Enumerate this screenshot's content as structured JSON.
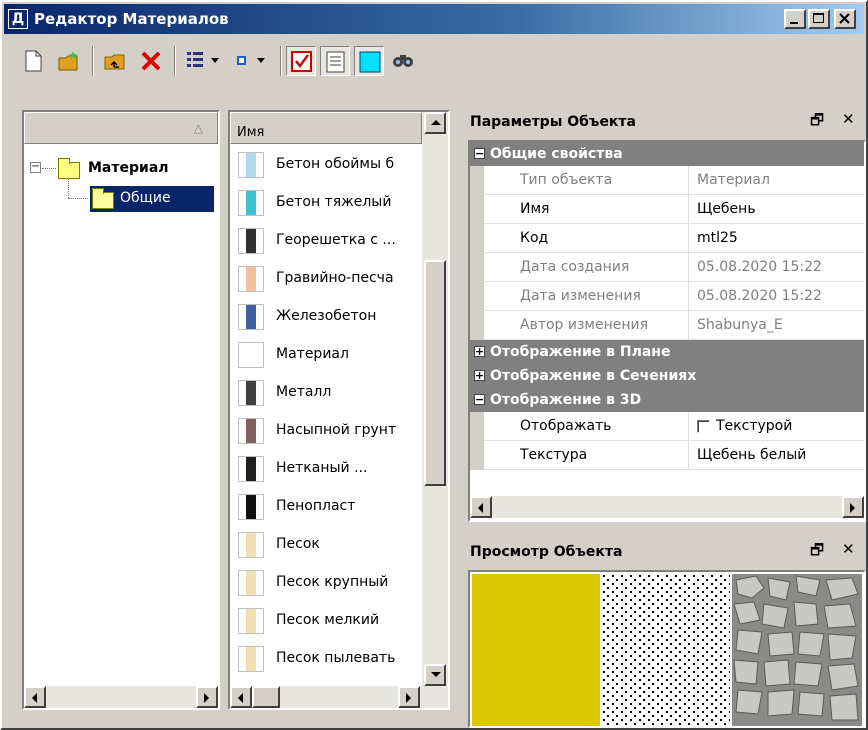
{
  "window": {
    "title": "Редактор Материалов",
    "app_icon_letter": "Д"
  },
  "toolbar": {
    "buttons": [
      {
        "name": "new-document-icon"
      },
      {
        "name": "new-folder-icon"
      },
      {
        "name": "up-folder-icon"
      },
      {
        "name": "delete-icon"
      },
      {
        "name": "view-list-icon"
      },
      {
        "name": "view-icons-icon"
      },
      {
        "name": "checkbox-icon"
      },
      {
        "name": "properties-icon"
      },
      {
        "name": "preview-icon"
      },
      {
        "name": "find-icon"
      }
    ]
  },
  "tree": {
    "header_sort_indicator": "△",
    "root_label": "Материал",
    "child_label": "Общие",
    "expander_symbol": "−"
  },
  "list": {
    "header": "Имя",
    "items": [
      {
        "label": "Бетон обоймы б",
        "swatch": "#b0d8e8"
      },
      {
        "label": "Бетон тяжелый",
        "swatch": "#40c0d0"
      },
      {
        "label": "Георешетка с ...",
        "swatch": "#303030"
      },
      {
        "label": "Гравийно-песча",
        "swatch": "#f0c0a0"
      },
      {
        "label": "Железобетон",
        "swatch": "#4060a0"
      },
      {
        "label": "Материал",
        "swatch": "#ffffff"
      },
      {
        "label": "Металл",
        "swatch": "#404040"
      },
      {
        "label": "Насыпной грунт",
        "swatch": "#806060"
      },
      {
        "label": "Нетканый ...",
        "swatch": "#202020"
      },
      {
        "label": "Пенопласт",
        "swatch": "#101010"
      },
      {
        "label": "Песок",
        "swatch": "#f0e0b0"
      },
      {
        "label": "Песок крупный",
        "swatch": "#f0e0b0"
      },
      {
        "label": "Песок мелкий",
        "swatch": "#f0e0b0"
      },
      {
        "label": "Песок пылевать",
        "swatch": "#f0e0b0"
      }
    ]
  },
  "properties": {
    "title": "Параметры Объекта",
    "groups": [
      {
        "label": "Общие свойства",
        "state": "−",
        "rows": [
          {
            "key": "Тип объекта",
            "value": "Материал",
            "readonly": true
          },
          {
            "key": "Имя",
            "value": "Щебень",
            "readonly": false
          },
          {
            "key": "Код",
            "value": "mtl25",
            "readonly": false
          },
          {
            "key": "Дата создания",
            "value": "05.08.2020 15:22",
            "readonly": true
          },
          {
            "key": "Дата изменения",
            "value": "05.08.2020 15:22",
            "readonly": true
          },
          {
            "key": "Автор изменения",
            "value": "Shabunya_E",
            "readonly": true
          }
        ]
      },
      {
        "label": "Отображение в Плане",
        "state": "+",
        "rows": []
      },
      {
        "label": "Отображение в Сечениях",
        "state": "+",
        "rows": []
      },
      {
        "label": "Отображение в 3D",
        "state": "−",
        "rows": [
          {
            "key": "Отображать",
            "value": "Текстурой",
            "readonly": false,
            "checkbox": true
          },
          {
            "key": "Текстура",
            "value": "Щебень белый",
            "readonly": false
          }
        ]
      }
    ]
  },
  "preview": {
    "title": "Просмотр Объекта",
    "fill_color": "#dcc800"
  },
  "panel_controls": {
    "restore_glyph": "🗗",
    "close_glyph": "✕"
  }
}
